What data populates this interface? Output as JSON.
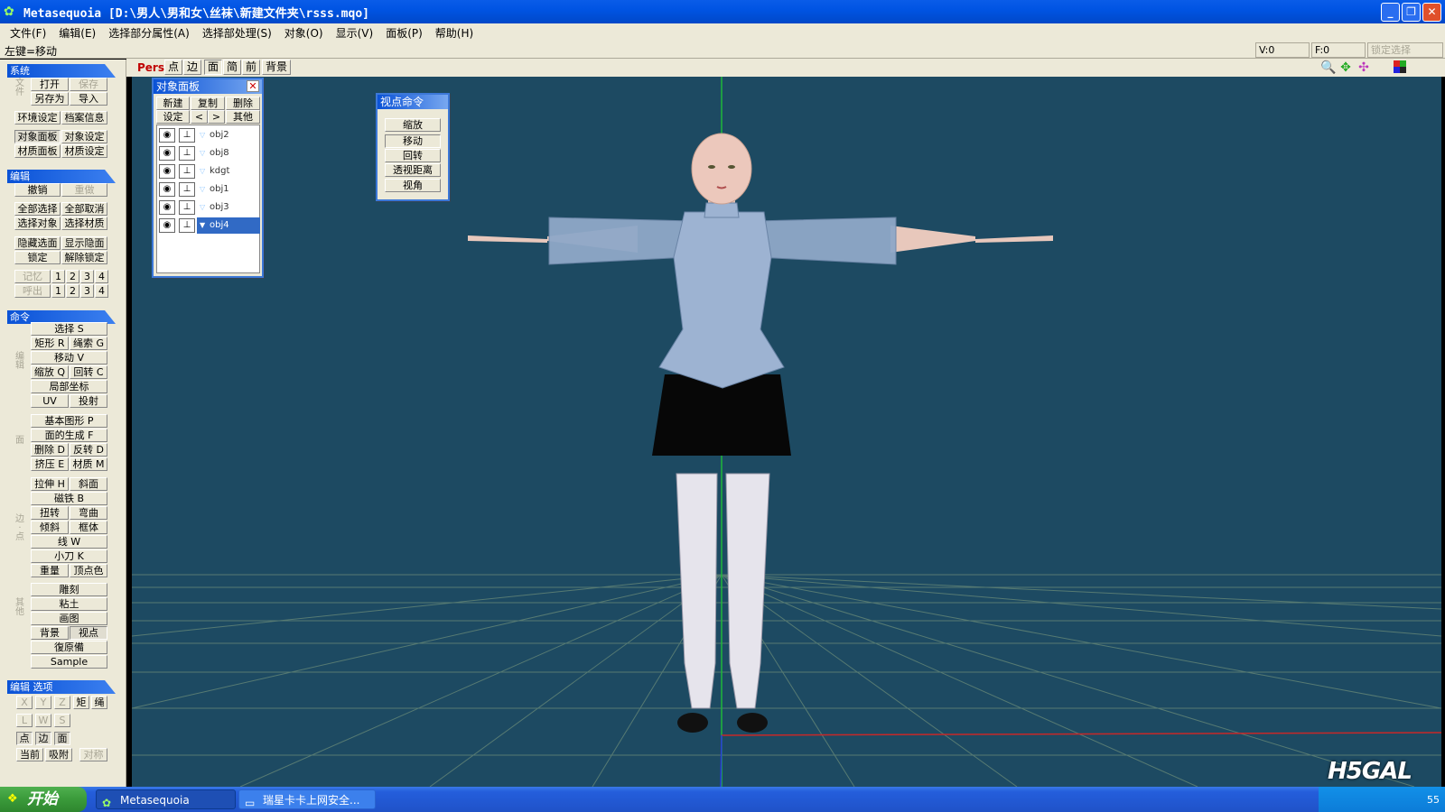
{
  "window": {
    "title": "Metasequoia [D:\\男人\\男和女\\丝袜\\新建文件夹\\rsss.mqo]",
    "min": "_",
    "max": "❐",
    "close": "✕"
  },
  "menu": [
    "文件(F)",
    "编辑(E)",
    "选择部分属性(A)",
    "选择部处理(S)",
    "对象(O)",
    "显示(V)",
    "面板(P)",
    "帮助(H)"
  ],
  "status": {
    "hint": "左键=移动",
    "v": "V:0",
    "f": "F:0",
    "lock": "锁定选择"
  },
  "left": {
    "sec_system": "系统",
    "sys_vlabel": "文件",
    "open": "打开",
    "save": "保存",
    "saveas": "另存为",
    "import": "导入",
    "env": "环境设定",
    "info": "档案信息",
    "objpanel": "对象面板",
    "objset": "对象设定",
    "matpanel": "材质面板",
    "matset": "材质设定",
    "sec_edit": "编辑",
    "undo": "撤销",
    "redo": "重做",
    "selall": "全部选择",
    "deselall": "全部取消",
    "selobj": "选择对象",
    "selmat": "选择材质",
    "hidesel": "隐藏选面",
    "showhid": "显示隐面",
    "lock": "锁定",
    "unlock": "解除锁定",
    "mem": "记忆",
    "call": "呼出",
    "n1": "1",
    "n2": "2",
    "n3": "3",
    "n4": "4",
    "sec_cmd": "命令",
    "v_edit": "编辑",
    "v_face": "面",
    "v_edge": "边·点",
    "v_etc": "其他",
    "select": "选择 S",
    "rect": "矩形 R",
    "lasso": "绳索 G",
    "move": "移动 V",
    "scale": "缩放 Q",
    "rotate": "回转 C",
    "local": "局部坐标",
    "uv": "UV",
    "project": "投射",
    "prim": "基本图形 P",
    "facegen": "面的生成 F",
    "delete": "删除 D",
    "flip": "反转 D",
    "extrude": "挤压 E",
    "material": "材质 M",
    "stretch": "拉伸 H",
    "bevel": "斜面",
    "magnet": "磁铁 B",
    "twist": "扭转",
    "bend": "弯曲",
    "tilt": "倾斜",
    "lattice": "框体",
    "line": "线 W",
    "knife": "小刀 K",
    "weight": "重量",
    "vcolor": "顶点色",
    "sculpt": "雕刻",
    "clay": "粘土",
    "paint": "画图",
    "bg": "背景",
    "viewpoint": "视点",
    "rec": "復原備",
    "sample": "Sample",
    "sec_opt": "编辑 选项",
    "x": "X",
    "y": "Y",
    "z": "Z",
    "rectopt": "矩",
    "rope": "绳",
    "l": "L",
    "w": "W",
    "s": "S",
    "pt": "点",
    "edge": "边",
    "face": "面",
    "current": "当前",
    "snap": "吸附",
    "sym": "对称"
  },
  "vtool": {
    "pers": "Pers",
    "point": "点",
    "edge": "边",
    "face": "面",
    "simple": "简",
    "front": "前",
    "bg": "背景"
  },
  "objectpanel": {
    "title": "对象面板",
    "new": "新建",
    "copy": "复制",
    "del": "删除",
    "set": "设定",
    "prev": "<",
    "next": ">",
    "other": "其他",
    "objects": [
      "obj2",
      "obj8",
      "kdgt",
      "obj1",
      "obj3",
      "obj4"
    ]
  },
  "viewcmd": {
    "title": "视点命令",
    "zoom": "缩放",
    "move": "移动",
    "rotate": "回转",
    "persp": "透视距离",
    "fov": "视角"
  },
  "taskbar": {
    "start": "开始",
    "task1": "Metasequoia",
    "task2": "瑞星卡卡上网安全...",
    "tray": "55"
  },
  "logo": "H5GAL",
  "colors": {
    "viewport": "#1d4a62",
    "accent": "#0a52d6",
    "selected": "#316ac5"
  }
}
